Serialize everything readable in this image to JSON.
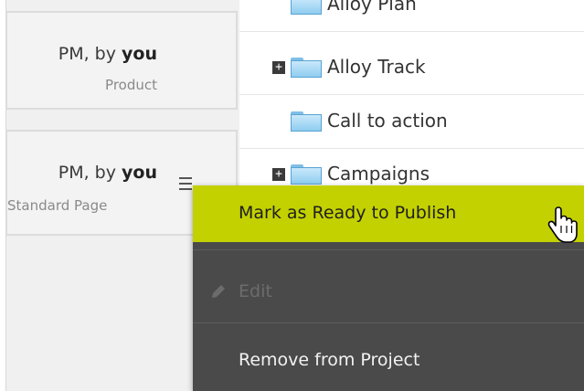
{
  "left_cards": [
    {
      "prefix": "PM, by ",
      "user": "you",
      "type": "Product"
    },
    {
      "prefix": "PM, by ",
      "user": "you",
      "type": "Standard Page"
    }
  ],
  "tree": {
    "items": [
      {
        "label": "Alloy Plan",
        "expandable": false
      },
      {
        "label": "Alloy Track",
        "expandable": true
      },
      {
        "label": "Call to action",
        "expandable": false
      },
      {
        "label": "Campaigns",
        "expandable": true
      }
    ],
    "expander_glyph": "+"
  },
  "context_menu": {
    "items": [
      {
        "label": "Mark as Ready to Publish",
        "state": "hovered"
      },
      {
        "label": "Edit",
        "state": "disabled",
        "icon": "pencil-icon"
      },
      {
        "label": "Remove from Project",
        "state": "normal"
      }
    ]
  },
  "colors": {
    "highlight": "#c3d100",
    "menu_bg": "#4a4a4a",
    "panel_bg": "#f0f0f0"
  }
}
